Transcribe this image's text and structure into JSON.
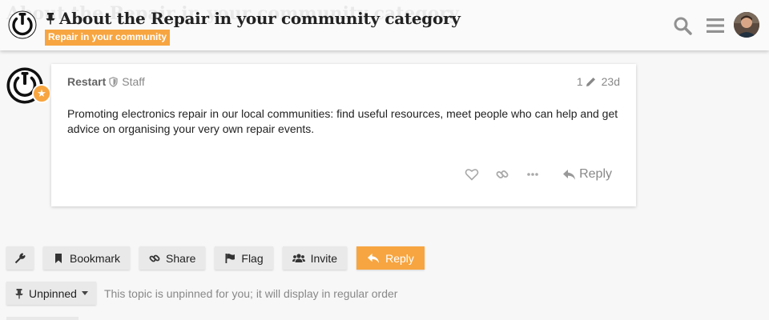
{
  "header": {
    "topic_title": "About the Repair in your community category",
    "category": "Repair in your community",
    "icons": [
      "power-logo",
      "pin-icon",
      "search-icon",
      "hamburger-icon",
      "user-avatar"
    ]
  },
  "post": {
    "username": "Restart",
    "user_title": "Staff",
    "edit_count": "1",
    "age": "23d",
    "body": "Promoting electronics repair in our local communities: find useful resources, meet people who can help and get advice on organising your very own repair events.",
    "reply_label": "Reply",
    "icons": [
      "heart-icon",
      "link-icon",
      "ellipsis-icon",
      "reply-icon"
    ]
  },
  "footer": {
    "bookmark_label": "Bookmark",
    "share_label": "Share",
    "flag_label": "Flag",
    "invite_label": "Invite",
    "reply_label": "Reply",
    "pin_state_label": "Unpinned",
    "pin_description": "This topic is unpinned for you; it will display in regular order"
  },
  "colors": {
    "accent": "#f7a540",
    "background": "#f7f7f7",
    "muted_text": "#888888"
  }
}
